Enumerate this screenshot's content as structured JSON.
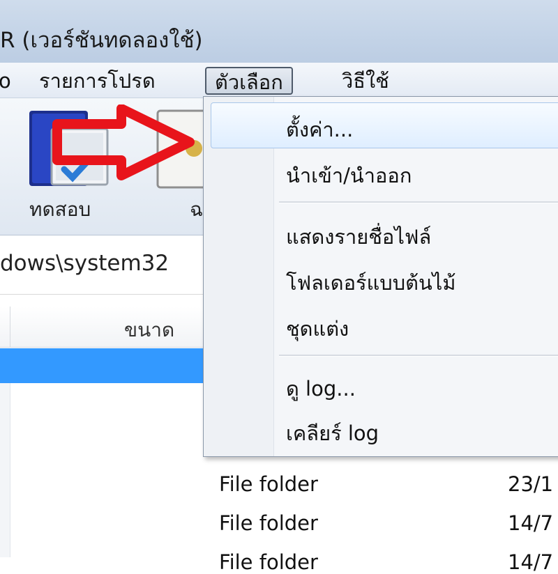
{
  "window": {
    "title": "R (เวอร์ชันทดลองใช้)"
  },
  "menubar": {
    "items": [
      {
        "label": "o"
      },
      {
        "label": "รายการโปรด"
      },
      {
        "label": "ตัวเลือก"
      },
      {
        "label": "วิธีใช้"
      }
    ]
  },
  "toolbar": {
    "test_label": "ทดสอบ",
    "next_label_fragment": "ฉ"
  },
  "path": {
    "value": "dows\\system32"
  },
  "list": {
    "columns": {
      "size": "ขนาด"
    },
    "rows": [
      {
        "type": "File folder",
        "date": "23/1"
      },
      {
        "type": "File folder",
        "date": "14/7"
      },
      {
        "type": "File folder",
        "date": "14/7"
      }
    ]
  },
  "dropdown": {
    "items": [
      {
        "label": "ตั้งค่า..."
      },
      {
        "label": "นำเข้า/นำออก"
      },
      {
        "label": "แสดงรายชื่อไฟล์"
      },
      {
        "label": "โฟลเดอร์แบบต้นไม้"
      },
      {
        "label": "ชุดแต่ง"
      },
      {
        "label": "ดู log..."
      },
      {
        "label": "เคลียร์ log"
      }
    ]
  },
  "colors": {
    "selection": "#3399ff",
    "arrow": "#e8141b"
  }
}
